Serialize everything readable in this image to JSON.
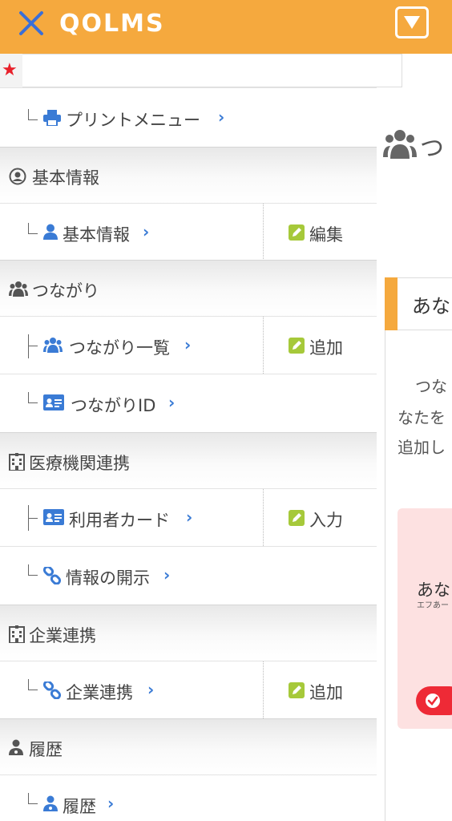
{
  "header": {
    "logo": "QOLMS",
    "close_icon": "close-x-icon",
    "menu_icon": "dropdown-square-icon",
    "colors": {
      "bar": "#f5a93e",
      "icon_blue": "#3a7bd5",
      "edit_green": "#a6c93a",
      "star_red": "#e8202a"
    }
  },
  "favorites": {
    "icon": "star-icon"
  },
  "menu": {
    "print": {
      "label": "プリントメニュー",
      "chevron": "›"
    },
    "basic": {
      "header": "基本情報",
      "item_label": "基本情報",
      "chevron": "›",
      "action": "編集"
    },
    "connections": {
      "header": "つながり",
      "list_label": "つながり一覧",
      "list_chevron": "›",
      "list_action": "追加",
      "id_label": "つながりID",
      "id_chevron": "›"
    },
    "medical": {
      "header": "医療機関連携",
      "card_label": "利用者カード",
      "card_chevron": "›",
      "card_action": "入力",
      "disclosure_label": "情報の開示",
      "disclosure_chevron": "›"
    },
    "corporate": {
      "header": "企業連携",
      "item_label": "企業連携",
      "chevron": "›",
      "action": "追加"
    },
    "history": {
      "header": "履歴",
      "item_label": "履歴",
      "chevron": "›"
    }
  },
  "main": {
    "title": "つ",
    "card_heading": "あな",
    "text_line1": "つな",
    "text_line2": "なたを",
    "text_line3": "追加し",
    "profile_name": "あな",
    "profile_kana": "エフあー"
  }
}
